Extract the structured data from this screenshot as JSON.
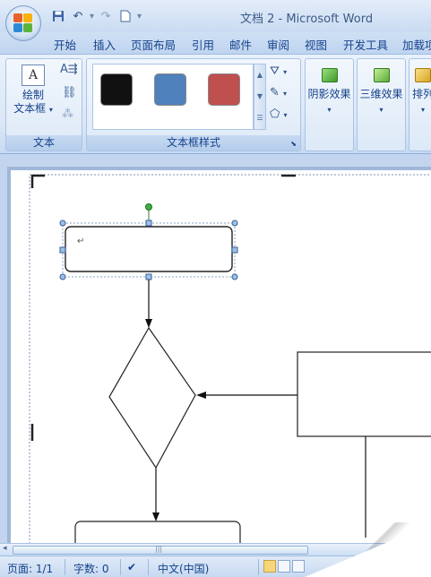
{
  "window": {
    "title": "文档 2 - Microsoft Word"
  },
  "quick_access": {
    "icons": [
      "save-icon",
      "undo-icon",
      "redo-icon",
      "new-document-icon",
      "customize-icon"
    ]
  },
  "tabs": [
    "开始",
    "插入",
    "页面布局",
    "引用",
    "邮件",
    "审阅",
    "视图",
    "开发工具",
    "加载项"
  ],
  "ribbon": {
    "text_group": {
      "label": "文本",
      "draw_textbox_line1": "绘制",
      "draw_textbox_line2": "文本框"
    },
    "textbox_styles": {
      "label": "文本框样式",
      "swatches": [
        "#111111",
        "#4f81bd",
        "#c0504d"
      ]
    },
    "shadow_effects": "阴影效果",
    "threed_effects": "三维效果",
    "arrange": "排列"
  },
  "document": {
    "textbox_paragraph_mark": "↵",
    "accent_handles": "#4f81bd",
    "rotate_handle": "#3cb043"
  },
  "status": {
    "page": "页面: 1/1",
    "words": "字数: 0",
    "language": "中文(中国)"
  }
}
